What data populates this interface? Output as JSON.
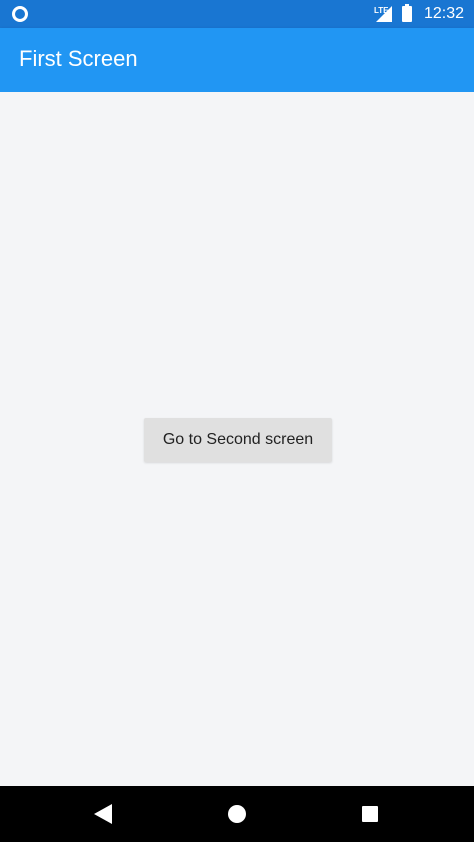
{
  "status_bar": {
    "network_label": "LTE",
    "time": "12:32"
  },
  "app_bar": {
    "title": "First Screen"
  },
  "main": {
    "button_label": "Go to Second screen"
  },
  "colors": {
    "status_bar": "#1976d2",
    "app_bar": "#2196f3",
    "background": "#f4f5f7",
    "button": "#e0e0e0",
    "nav_bar": "#000000"
  },
  "icons": {
    "status_left": "circle-icon",
    "signal": "signal-icon",
    "battery": "battery-icon",
    "nav_back": "back-icon",
    "nav_home": "home-icon",
    "nav_recent": "recent-apps-icon"
  }
}
